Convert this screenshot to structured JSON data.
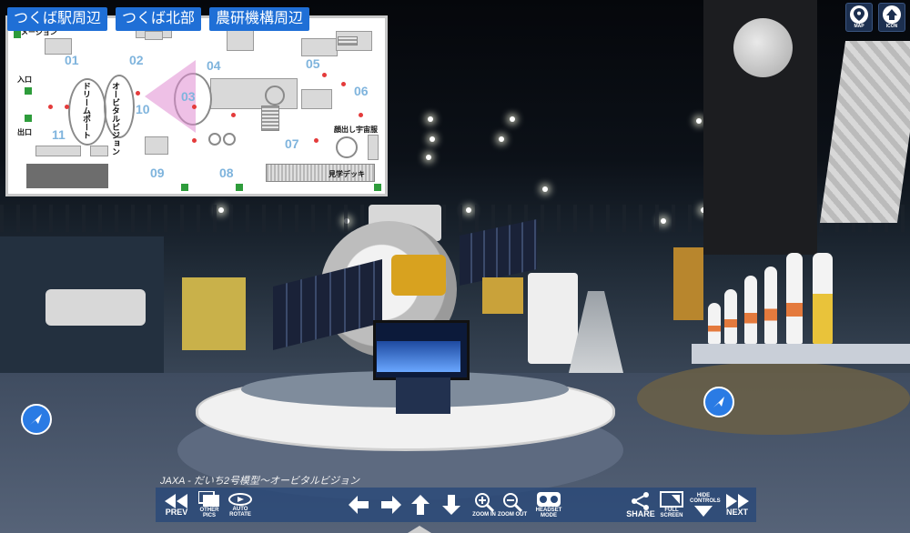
{
  "area_tabs": [
    "つくば駅周辺",
    "つくば北部",
    "農研機構周辺"
  ],
  "map": {
    "zones": [
      "01",
      "02",
      "03",
      "04",
      "05",
      "06",
      "07",
      "08",
      "09",
      "10",
      "11"
    ],
    "labels": {
      "messaging": "メージョン",
      "entrance": "入口",
      "exit": "出口",
      "dream_port": "ドリームポート",
      "orbital_vision": "オービタルビジョン",
      "spacesuit": "顔出し宇宙服",
      "observation_deck": "見学デッキ"
    }
  },
  "top_right": {
    "map_label": "MAP",
    "icon_label": "ICON"
  },
  "caption": "JAXA - だいち2号模型～オービタルビジョン",
  "toolbar": {
    "prev": "PREV",
    "other_pics": "OTHER PICS",
    "auto_rotate": "AUTO ROTATE",
    "zoom_in": "ZOOM IN",
    "zoom_out": "ZOOM OUT",
    "headset_mode": "HEADSET MODE",
    "share": "SHARE",
    "full_screen": "FULL SCREEN",
    "hide_controls": "HIDE CONTROLS",
    "next": "NEXT"
  },
  "colors": {
    "tab_bg": "#1f6fd6",
    "hotspot": "#2a7be4",
    "toolbar_bg": "#284878",
    "map_zone": "#7fb4dd",
    "map_dot": "#e43b3b",
    "view_cone": "#e08cd2"
  },
  "icons": {
    "hotspot": "navigate-arrow-icon",
    "map": "map-pin-icon",
    "icon": "person-icon"
  }
}
